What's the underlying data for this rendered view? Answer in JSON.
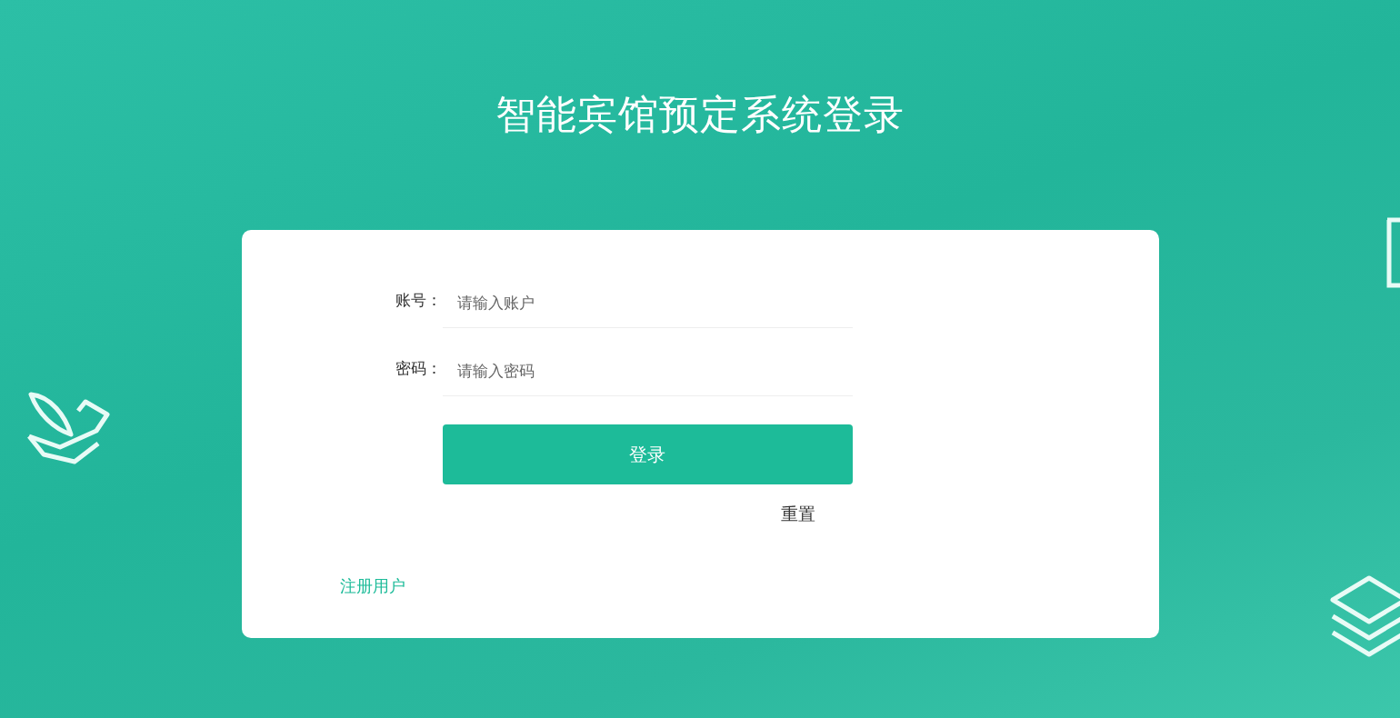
{
  "title": "智能宾馆预定系统登录",
  "form": {
    "fields": [
      {
        "label": "账号：",
        "placeholder": "请输入账户"
      },
      {
        "label": "密码：",
        "placeholder": "请输入密码"
      }
    ],
    "login_button": "登录",
    "reset_link": "重置",
    "register_link": "注册用户"
  }
}
